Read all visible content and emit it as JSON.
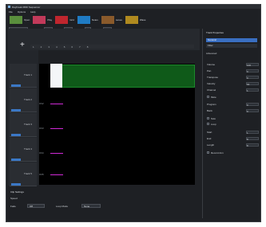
{
  "window": {
    "title": "Daybreak MIDI Sequencer",
    "menus": [
      "File",
      "Options",
      "Help"
    ]
  },
  "toolbar": {
    "buttons": [
      {
        "label": "Open",
        "color": "#5a8f3d"
      },
      {
        "label": "Play",
        "color": "#c23a5a"
      },
      {
        "label": "Grid",
        "color": "#c0262e"
      },
      {
        "label": "Notes",
        "color": "#1f7bc4"
      },
      {
        "label": "Lanes",
        "color": "#8a5a2b"
      },
      {
        "label": "Wave",
        "color": "#b08a1f"
      }
    ]
  },
  "options_bar": {
    "snap_label": "Snap to Note",
    "quantize_label": "Quantize",
    "quantize_value": "1/16",
    "grid_label": "Grid",
    "grid_value": "Bar",
    "beats_label": "Beats",
    "beats_value": "4",
    "tempo_label": "BPM",
    "tempo_value": "120"
  },
  "timeline": {
    "ruler": [
      "1",
      "2",
      "3",
      "4",
      "5",
      "6",
      "7",
      "8"
    ],
    "track_header": "Track List"
  },
  "tracks": [
    {
      "name": "Track 1",
      "channel": "Ch1"
    },
    {
      "name": "Track 2",
      "channel": "Ch2"
    },
    {
      "name": "Track 3",
      "channel": "Ch3"
    },
    {
      "name": "Track 4",
      "channel": "Ch4"
    },
    {
      "name": "Track 5",
      "channel": "Ch5"
    }
  ],
  "properties": {
    "header": "Track Properties",
    "tabs": [
      "General",
      "Filter",
      "Advanced"
    ],
    "rows": [
      {
        "label": "Volume",
        "value": "100"
      },
      {
        "label": "Pan",
        "value": "0"
      },
      {
        "label": "Transpose",
        "value": "0"
      },
      {
        "label": "Velocity",
        "value": "64"
      },
      {
        "label": "Channel",
        "value": "1"
      },
      {
        "label": "Program",
        "value": "0"
      },
      {
        "label": "Bank",
        "value": "0"
      }
    ],
    "checks": [
      "Mute",
      "Solo",
      "Loop",
      "Record Arm"
    ],
    "rows2": [
      {
        "label": "Start",
        "value": "1"
      },
      {
        "label": "End",
        "value": "8"
      },
      {
        "label": "Length",
        "value": "8"
      }
    ]
  },
  "bottom": {
    "section_label": "Clip Settings",
    "speed_label": "Speed",
    "loop_label": "Loop Mode",
    "loop_value": "None",
    "fade_label": "Fade",
    "fade_value": "Off"
  }
}
